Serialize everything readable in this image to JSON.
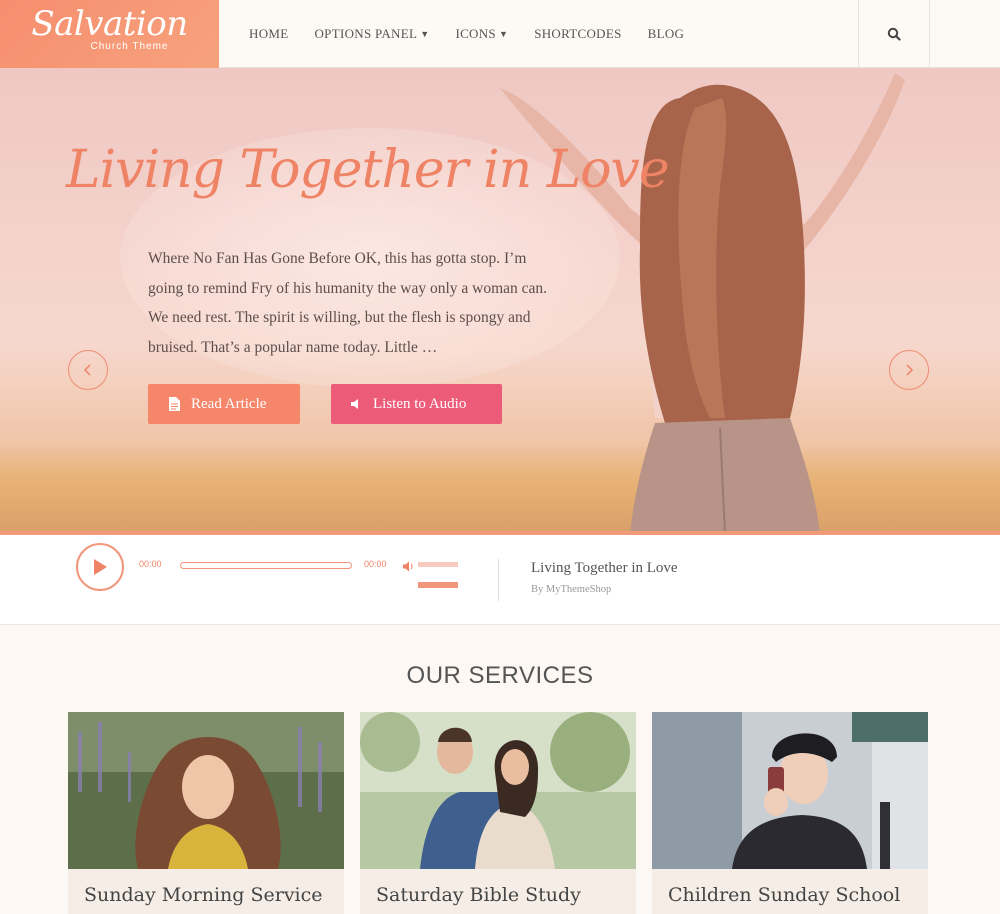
{
  "brand": {
    "title": "Salvation",
    "subtitle": "Church Theme",
    "accent": "#f5866a",
    "accent2": "#ec5c79"
  },
  "nav": {
    "items": [
      {
        "label": "HOME",
        "dropdown": false
      },
      {
        "label": "OPTIONS PANEL",
        "dropdown": true
      },
      {
        "label": "ICONS",
        "dropdown": true
      },
      {
        "label": "SHORTCODES",
        "dropdown": false
      },
      {
        "label": "BLOG",
        "dropdown": false
      }
    ],
    "search_icon": "search-icon"
  },
  "hero": {
    "title": "Living Together in Love",
    "text": "Where No Fan Has Gone Before OK, this has gotta stop. I’m going to remind Fry of his humanity the way only a woman can. We need rest. The spirit is willing, but the flesh is spongy and bruised. That’s a popular name today. Little …",
    "read_label": "Read Article",
    "audio_label": "Listen to Audio",
    "prev_icon": "chevron-left-icon",
    "next_icon": "chevron-right-icon"
  },
  "player": {
    "current_time": "00:00",
    "duration": "00:00",
    "progress": 0,
    "track_title": "Living Together in Love",
    "track_by": "By MyThemeShop"
  },
  "services": {
    "title": "OUR SERVICES",
    "cards": [
      {
        "label": "Sunday Morning Service"
      },
      {
        "label": "Saturday Bible Study"
      },
      {
        "label": "Children Sunday School"
      }
    ]
  }
}
